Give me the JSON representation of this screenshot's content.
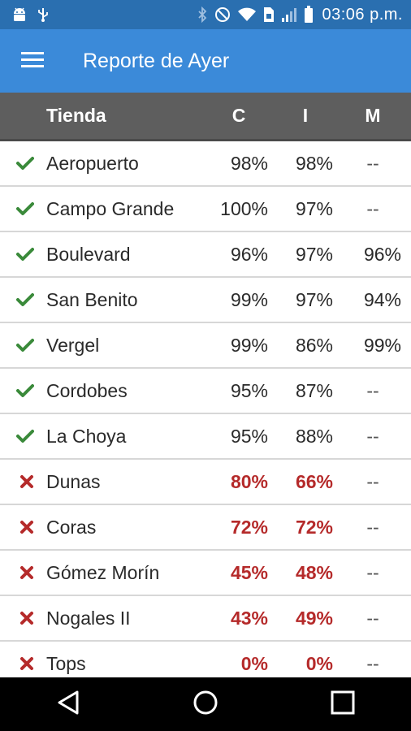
{
  "status_bar": {
    "time": "03:06 p.m.",
    "icons": [
      "android-icon",
      "usb-icon",
      "bluetooth-icon",
      "do-not-disturb-icon",
      "wifi-icon",
      "sim-icon",
      "signal-icon",
      "battery-icon"
    ]
  },
  "app_bar": {
    "title": "Reporte de Ayer",
    "menu_icon": "hamburger-menu-icon"
  },
  "table": {
    "headers": {
      "store": "Tienda",
      "c": "C",
      "i": "I",
      "m": "M"
    },
    "rows": [
      {
        "ok": true,
        "store": "Aeropuerto",
        "c": "98%",
        "i": "98%",
        "m": "--"
      },
      {
        "ok": true,
        "store": "Campo Grande",
        "c": "100%",
        "i": "97%",
        "m": "--"
      },
      {
        "ok": true,
        "store": "Boulevard",
        "c": "96%",
        "i": "97%",
        "m": "96%"
      },
      {
        "ok": true,
        "store": "San Benito",
        "c": "99%",
        "i": "97%",
        "m": "94%"
      },
      {
        "ok": true,
        "store": "Vergel",
        "c": "99%",
        "i": "86%",
        "m": "99%"
      },
      {
        "ok": true,
        "store": "Cordobes",
        "c": "95%",
        "i": "87%",
        "m": "--"
      },
      {
        "ok": true,
        "store": "La Choya",
        "c": "95%",
        "i": "88%",
        "m": "--"
      },
      {
        "ok": false,
        "store": "Dunas",
        "c": "80%",
        "i": "66%",
        "m": "--"
      },
      {
        "ok": false,
        "store": "Coras",
        "c": "72%",
        "i": "72%",
        "m": "--"
      },
      {
        "ok": false,
        "store": "Gómez Morín",
        "c": "45%",
        "i": "48%",
        "m": "--"
      },
      {
        "ok": false,
        "store": "Nogales II",
        "c": "43%",
        "i": "49%",
        "m": "--"
      },
      {
        "ok": false,
        "store": "Tops",
        "c": "0%",
        "i": "0%",
        "m": "--"
      }
    ]
  },
  "colors": {
    "status_bar": "#2a6fb0",
    "app_bar": "#3b8ad9",
    "header": "#5e5e5e",
    "ok": "#3a8a3a",
    "bad": "#b52a2a"
  },
  "nav_bar": {
    "icons": [
      "back-icon",
      "home-icon",
      "recent-apps-icon"
    ]
  }
}
